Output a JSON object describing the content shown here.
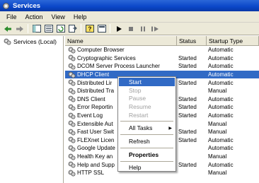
{
  "window": {
    "title": "Services"
  },
  "menu": [
    "File",
    "Action",
    "View",
    "Help"
  ],
  "toolbar": {
    "buttons": [
      "back-arrow",
      "forward-arrow",
      "show-hide-tree",
      "properties",
      "refresh",
      "export-list",
      "help",
      "console-tree",
      "start-service",
      "stop-service",
      "pause-service",
      "restart-service"
    ]
  },
  "tree": {
    "root_label": "Services (Local)"
  },
  "columns": {
    "name": "Name",
    "status": "Status",
    "startup": "Startup Type"
  },
  "services": [
    {
      "name": "Computer Browser",
      "status": "",
      "startup": "Automatic"
    },
    {
      "name": "Cryptographic Services",
      "status": "Started",
      "startup": "Automatic"
    },
    {
      "name": "DCOM Server Process Launcher",
      "status": "Started",
      "startup": "Automatic"
    },
    {
      "name": "DHCP Client",
      "status": "",
      "startup": "Automatic"
    },
    {
      "name": "Distributed Lir",
      "status": "Started",
      "startup": "Automatic"
    },
    {
      "name": "Distributed Tra",
      "status": "",
      "startup": "Manual"
    },
    {
      "name": "DNS Client",
      "status": "Started",
      "startup": "Automatic"
    },
    {
      "name": "Error Reportin",
      "status": "Started",
      "startup": "Automatic"
    },
    {
      "name": "Event Log",
      "status": "Started",
      "startup": "Automatic"
    },
    {
      "name": "Extensible Aut",
      "status": "",
      "startup": "Manual"
    },
    {
      "name": "Fast User Swit",
      "status": "Started",
      "startup": "Manual"
    },
    {
      "name": "FLEXnet Licen",
      "status": "Started",
      "startup": "Automatic"
    },
    {
      "name": "Google Update",
      "status": "",
      "startup": "Automatic"
    },
    {
      "name": "Health Key an",
      "status": "",
      "startup": "Manual"
    },
    {
      "name": "Help and Supp",
      "status": "Started",
      "startup": "Automatic"
    },
    {
      "name": "HTTP SSL",
      "status": "",
      "startup": "Manual"
    }
  ],
  "selected_row": "DHCP Client",
  "context_menu": {
    "start": "Start",
    "stop": "Stop",
    "pause": "Pause",
    "resume": "Resume",
    "restart": "Restart",
    "all_tasks": "All Tasks",
    "refresh": "Refresh",
    "properties": "Properties",
    "help": "Help"
  },
  "colors": {
    "titlebar": "#0a46c8",
    "selection": "#316ac5",
    "chrome": "#ece9d8"
  }
}
